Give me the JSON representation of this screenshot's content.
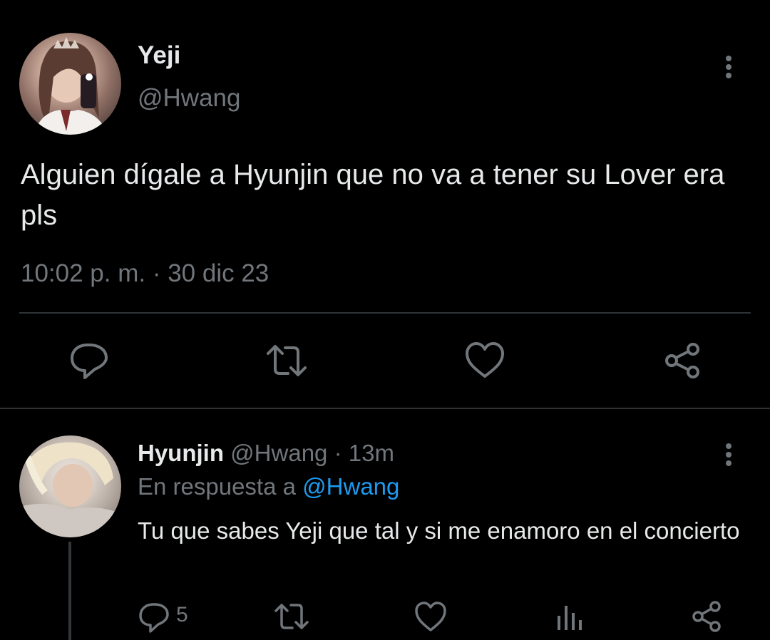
{
  "tweet": {
    "author_name": "Yeji",
    "author_handle": "@Hwang",
    "text": "Alguien dígale a Hyunjin que no va a tener su Lover era pls",
    "timestamp": "10:02 p. m. · 30 dic 23",
    "actions": [
      "reply-icon",
      "retweet-icon",
      "like-icon",
      "share-icon"
    ]
  },
  "reply": {
    "author_name": "Hyunjin",
    "author_handle": "@Hwang",
    "time_sep": "·",
    "time": "13m",
    "replying_to_prefix": "En respuesta a",
    "replying_to_handle": "@Hwang",
    "text": "Tu que sabes Yeji que tal y si me enamoro en el concierto",
    "reply_count": "5",
    "actions": [
      "reply-icon",
      "retweet-icon",
      "like-icon",
      "views-icon",
      "share-icon"
    ]
  },
  "colors": {
    "background": "#000000",
    "primary_text": "#e7e9ea",
    "secondary_text": "#71767b",
    "divider": "#2f3336",
    "link": "#1d9bf0"
  }
}
